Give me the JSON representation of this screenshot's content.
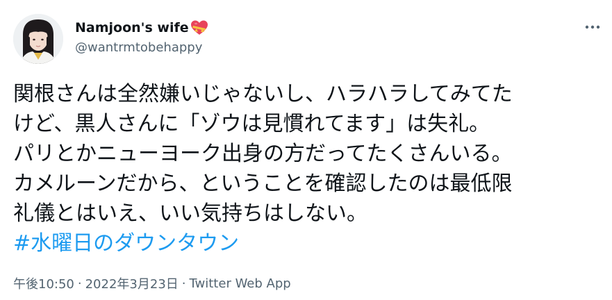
{
  "user": {
    "display_name": "Namjoon's wife",
    "handle": "@wantrmtobehappy",
    "name_emoji": "heart-with-ribbon-icon"
  },
  "tweet": {
    "lines": [
      "関根さんは全然嫌いじゃないし、ハラハラしてみてた",
      "けど、黒人さんに「ゾウは見慣れてます」は失礼。",
      "パリとかニューヨーク出身の方だってたくさんいる。",
      "カメルーンだから、ということを確認したのは最低限",
      "礼儀とはいえ、いい気持ちはしない。"
    ],
    "hashtag": "#水曜日のダウンタウン"
  },
  "meta": {
    "time": "午後10:50",
    "separator": "·",
    "date": "2022年3月23日",
    "source": "Twitter Web App"
  },
  "colors": {
    "text": "#0f1419",
    "secondary": "#536471",
    "link": "#1d9bf0"
  }
}
